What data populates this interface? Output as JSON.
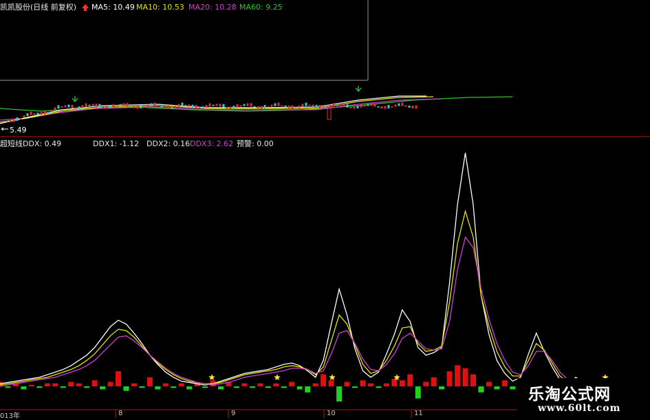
{
  "colors": {
    "background": "#000000",
    "grid": "#b01818",
    "text_white": "#e8e8e8",
    "ma5": "#ffffff",
    "ma10": "#e6e600",
    "ma20": "#d040d0",
    "ma60": "#2ec82e",
    "bar_up": "#e01010",
    "bar_down": "#20d020",
    "star": "#ffe040"
  },
  "price_panel": {
    "title": "凯凯股份(日线 前复权)",
    "ma5_label": "MA5: 10.49",
    "ma10_label": "MA10: 10.53",
    "ma20_label": "MA20: 10.28",
    "ma60_label": "MA60: 9.25",
    "low_price_label": "5.49"
  },
  "ddx_panel": {
    "name": "超短线",
    "ddx_label": "DDX: 0.49",
    "ddx1_label": "DDX1: -1.12",
    "ddx2_label": "DDX2: 0.16",
    "ddx3_label": "DDX3: 2.62",
    "alert_label": "预警: 0.00"
  },
  "x_axis": {
    "labels": [
      "013年",
      "8",
      "9",
      "10",
      "11"
    ]
  },
  "watermark": {
    "title": "乐淘公式网",
    "url": "www.60lt.com"
  },
  "chart_data": {
    "type": "line",
    "title": "",
    "series": [
      {
        "name": "DDX1",
        "values": [
          4,
          6,
          8,
          10,
          12,
          14,
          18,
          22,
          26,
          32,
          40,
          48,
          60,
          76,
          92,
          102,
          96,
          82,
          66,
          48,
          34,
          22,
          14,
          8,
          6,
          4,
          2,
          4,
          8,
          12,
          16,
          20,
          22,
          24,
          26,
          30,
          34,
          36,
          32,
          24,
          14,
          40,
          96,
          150,
          110,
          58,
          24,
          14,
          22,
          50,
          80,
          118,
          100,
          60,
          48,
          52,
          60,
          160,
          280,
          360,
          280,
          140,
          80,
          40,
          20,
          8,
          14,
          50,
          82,
          54,
          30,
          10,
          4,
          14,
          6,
          4
        ]
      },
      {
        "name": "DDX2",
        "values": [
          2,
          4,
          6,
          8,
          10,
          12,
          14,
          18,
          22,
          26,
          32,
          40,
          50,
          64,
          78,
          88,
          86,
          76,
          62,
          48,
          36,
          26,
          18,
          12,
          8,
          6,
          4,
          4,
          6,
          10,
          14,
          18,
          20,
          22,
          24,
          26,
          30,
          32,
          30,
          26,
          18,
          30,
          70,
          110,
          96,
          64,
          34,
          20,
          24,
          40,
          62,
          90,
          92,
          66,
          54,
          56,
          62,
          130,
          220,
          270,
          230,
          140,
          92,
          54,
          30,
          16,
          16,
          40,
          66,
          56,
          36,
          16,
          6,
          10,
          6,
          4
        ]
      },
      {
        "name": "DDX3",
        "values": [
          0,
          2,
          4,
          6,
          8,
          10,
          12,
          14,
          18,
          22,
          26,
          32,
          40,
          52,
          64,
          76,
          78,
          70,
          60,
          48,
          38,
          28,
          20,
          14,
          10,
          6,
          4,
          2,
          4,
          6,
          10,
          14,
          16,
          18,
          20,
          22,
          24,
          28,
          28,
          26,
          20,
          24,
          50,
          82,
          86,
          66,
          42,
          26,
          24,
          34,
          50,
          74,
          82,
          70,
          58,
          56,
          58,
          100,
          180,
          230,
          214,
          150,
          104,
          66,
          40,
          22,
          18,
          32,
          54,
          54,
          40,
          22,
          10,
          8,
          6,
          4
        ]
      },
      {
        "name": "DDX",
        "values": [
          3,
          -1,
          2,
          -2,
          1,
          -1,
          2,
          2,
          -1,
          3,
          2,
          -1,
          4,
          -2,
          3,
          10,
          -3,
          2,
          -1,
          6,
          -2,
          2,
          -1,
          2,
          -2,
          2,
          -1,
          4,
          -2,
          3,
          -1,
          2,
          -1,
          2,
          -1,
          2,
          -1,
          3,
          -2,
          -4,
          2,
          8,
          4,
          -10,
          3,
          -1,
          4,
          2,
          -1,
          2,
          5,
          4,
          8,
          -8,
          3,
          6,
          -2,
          10,
          14,
          12,
          8,
          -4,
          3,
          -2,
          4,
          -2,
          2,
          -3,
          2,
          -1,
          2,
          -1,
          4,
          2,
          -2,
          1
        ]
      }
    ],
    "alert_points": [
      14,
      19,
      23,
      27,
      30
    ],
    "ylim": [
      -12,
      365
    ],
    "xlabel": "",
    "ylabel": ""
  }
}
